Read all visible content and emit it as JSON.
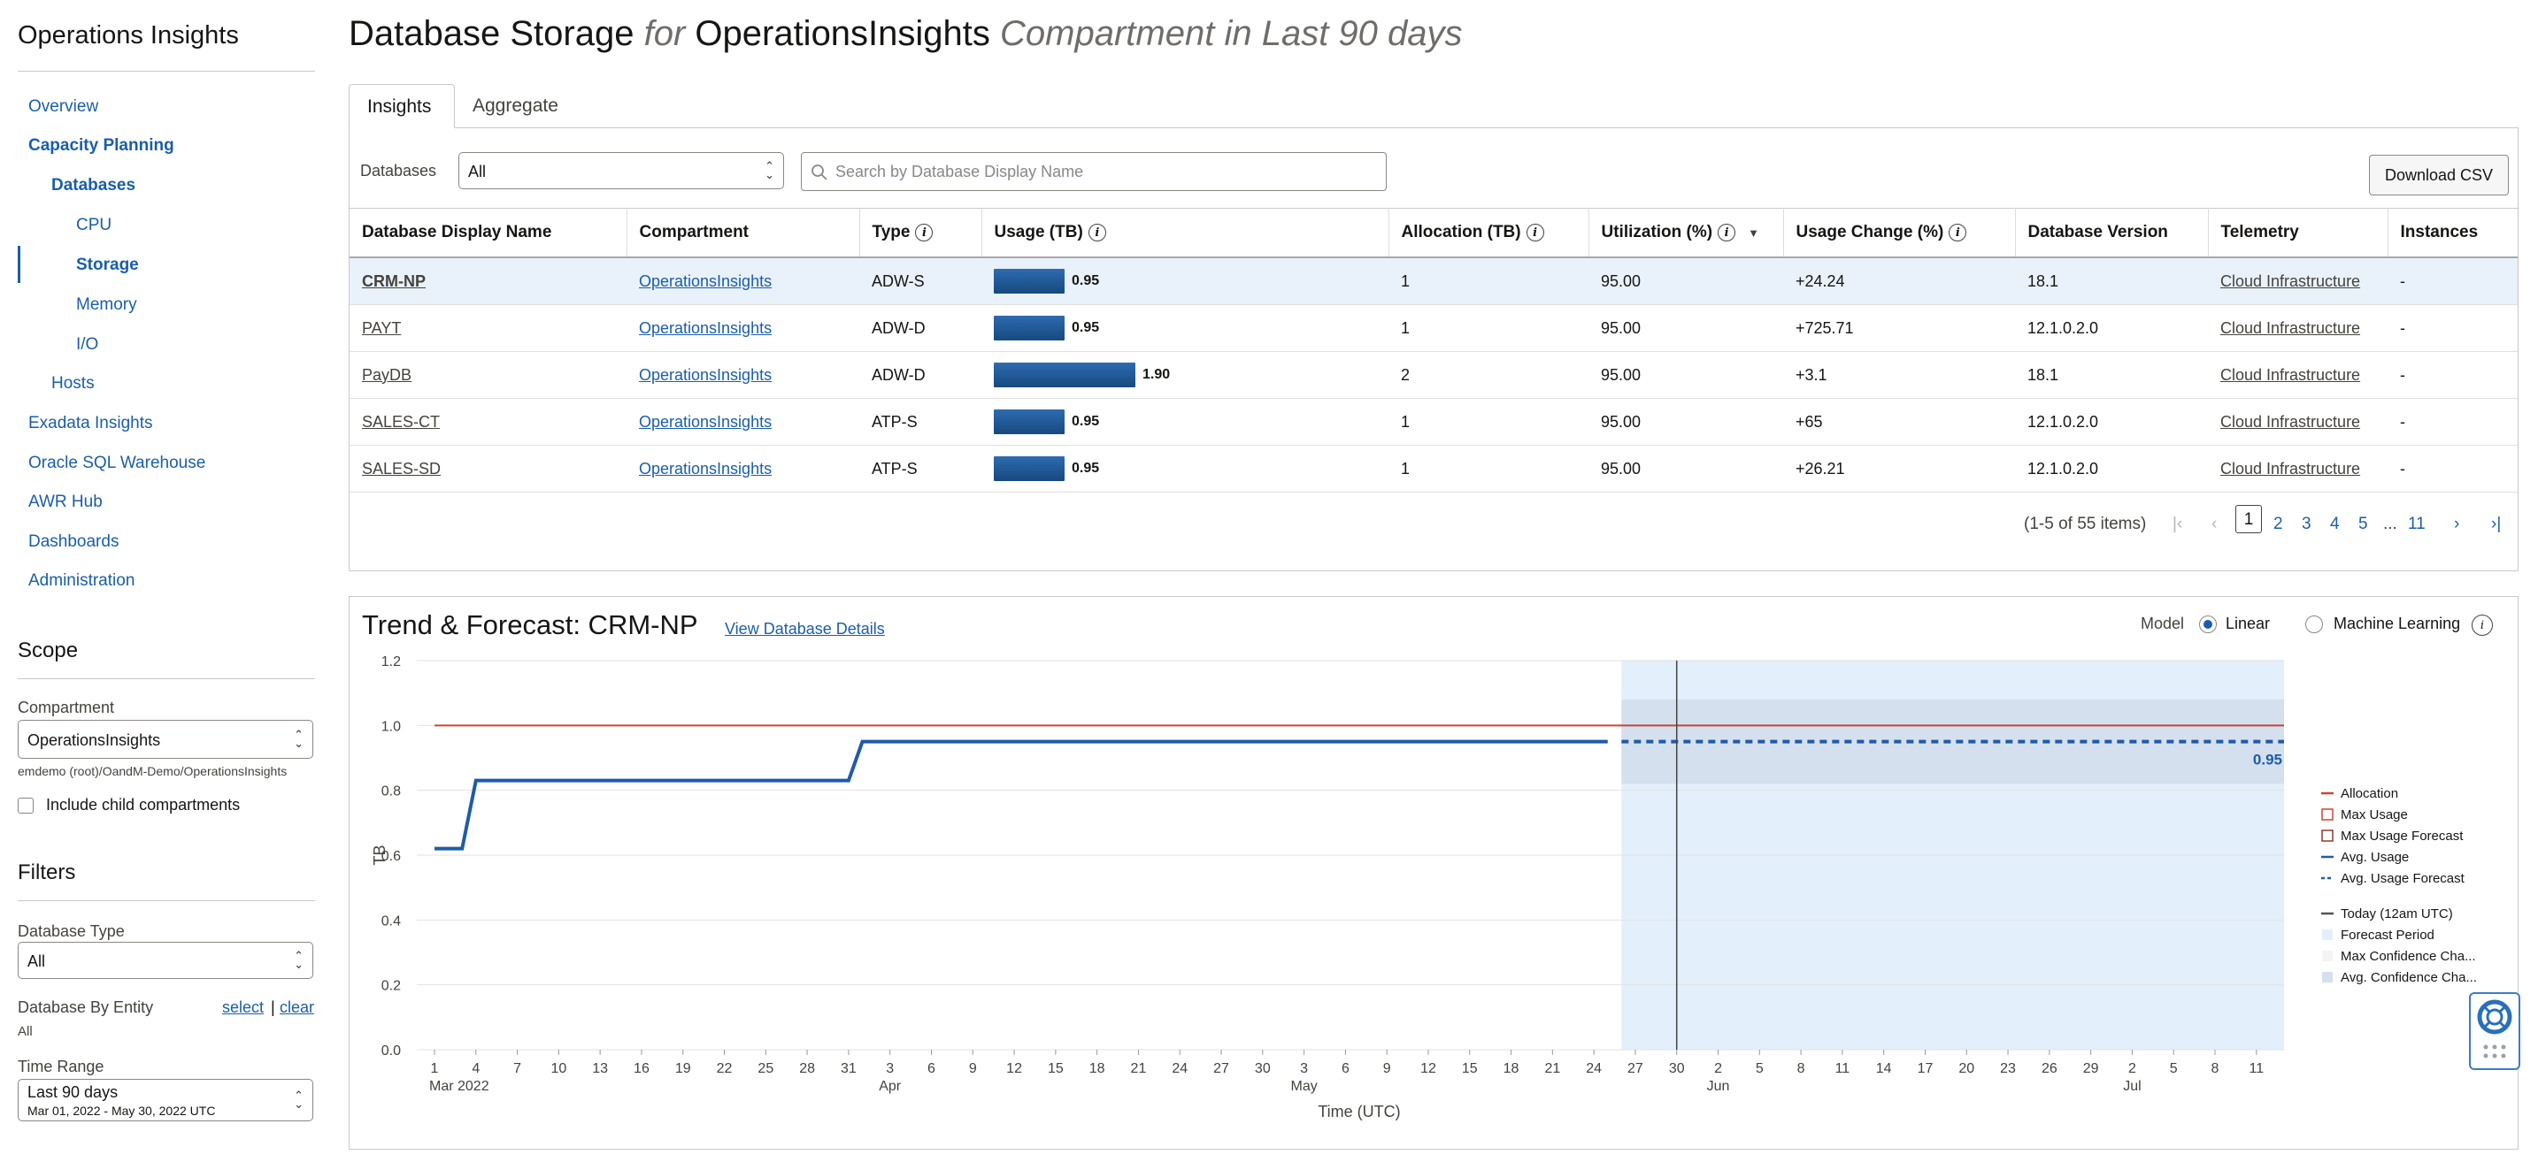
{
  "sidebar": {
    "app_title": "Operations Insights",
    "nav": [
      {
        "label": "Overview"
      },
      {
        "label": "Capacity Planning"
      },
      {
        "label": "Databases"
      },
      {
        "label": "CPU"
      },
      {
        "label": "Storage"
      },
      {
        "label": "Memory"
      },
      {
        "label": "I/O"
      },
      {
        "label": "Hosts"
      },
      {
        "label": "Exadata Insights"
      },
      {
        "label": "Oracle SQL Warehouse"
      },
      {
        "label": "AWR Hub"
      },
      {
        "label": "Dashboards"
      },
      {
        "label": "Administration"
      }
    ],
    "scope": {
      "title": "Scope",
      "compartment_label": "Compartment",
      "compartment_value": "OperationsInsights",
      "compartment_path": "emdemo (root)/OandM-Demo/OperationsInsights",
      "include_child_label": "Include child compartments"
    },
    "filters": {
      "title": "Filters",
      "db_type_label": "Database Type",
      "db_type_value": "All",
      "db_entity_label": "Database By Entity",
      "select_link": "select",
      "separator": "|",
      "clear_link": "clear",
      "db_entity_value": "All",
      "time_range_label": "Time Range",
      "time_range_value": "Last 90 days",
      "time_range_sub": "Mar 01, 2022 - May 30, 2022 UTC"
    }
  },
  "header": {
    "title_main": "Database Storage",
    "title_for": "for",
    "title_comp": "OperationsInsights",
    "title_suffix": "Compartment in Last 90 days"
  },
  "tabs": [
    {
      "label": "Insights"
    },
    {
      "label": "Aggregate"
    }
  ],
  "toolbar": {
    "databases_label": "Databases",
    "databases_value": "All",
    "search_placeholder": "Search by Database Display Name",
    "download_label": "Download CSV"
  },
  "table": {
    "columns": [
      "Database Display Name",
      "Compartment",
      "Type",
      "Usage (TB)",
      "Allocation (TB)",
      "Utilization (%)",
      "Usage Change (%)",
      "Database Version",
      "Telemetry",
      "Instances"
    ],
    "rows": [
      {
        "name": "CRM-NP",
        "compartment": "OperationsInsights",
        "type": "ADW-S",
        "usage": 0.95,
        "usage_label": "0.95",
        "allocation": "1",
        "utilization": "95.00",
        "change": "+24.24",
        "version": "18.1",
        "telemetry": "Cloud Infrastructure",
        "instances": "-"
      },
      {
        "name": "PAYT",
        "compartment": "OperationsInsights",
        "type": "ADW-D",
        "usage": 0.95,
        "usage_label": "0.95",
        "allocation": "1",
        "utilization": "95.00",
        "change": "+725.71",
        "version": "12.1.0.2.0",
        "telemetry": "Cloud Infrastructure",
        "instances": "-"
      },
      {
        "name": "PayDB",
        "compartment": "OperationsInsights",
        "type": "ADW-D",
        "usage": 1.9,
        "usage_label": "1.90",
        "allocation": "2",
        "utilization": "95.00",
        "change": "+3.1",
        "version": "18.1",
        "telemetry": "Cloud Infrastructure",
        "instances": "-"
      },
      {
        "name": "SALES-CT",
        "compartment": "OperationsInsights",
        "type": "ATP-S",
        "usage": 0.95,
        "usage_label": "0.95",
        "allocation": "1",
        "utilization": "95.00",
        "change": "+65",
        "version": "12.1.0.2.0",
        "telemetry": "Cloud Infrastructure",
        "instances": "-"
      },
      {
        "name": "SALES-SD",
        "compartment": "OperationsInsights",
        "type": "ATP-S",
        "usage": 0.95,
        "usage_label": "0.95",
        "allocation": "1",
        "utilization": "95.00",
        "change": "+26.21",
        "version": "12.1.0.2.0",
        "telemetry": "Cloud Infrastructure",
        "instances": "-"
      }
    ],
    "usage_max": 1.9
  },
  "pagination": {
    "summary": "(1-5 of 55 items)",
    "current": "1",
    "pages": [
      "2",
      "3",
      "4",
      "5"
    ],
    "ellipsis": "...",
    "last": "11"
  },
  "trend": {
    "title": "Trend & Forecast: CRM-NP",
    "link": "View Database Details",
    "model_label": "Model",
    "model_linear": "Linear",
    "model_ml": "Machine Learning"
  },
  "chart_data": {
    "type": "line",
    "ylabel": "TB",
    "xlabel": "Time (UTC)",
    "ylim": [
      0,
      1.2
    ],
    "yticks": [
      "0.0",
      "0.2",
      "0.4",
      "0.6",
      "0.8",
      "1.0",
      "1.2"
    ],
    "xticks": [
      "1",
      "4",
      "7",
      "10",
      "13",
      "16",
      "19",
      "22",
      "25",
      "28",
      "31",
      "3",
      "6",
      "9",
      "12",
      "15",
      "18",
      "21",
      "24",
      "27",
      "30",
      "3",
      "6",
      "9",
      "12",
      "15",
      "18",
      "21",
      "24",
      "27",
      "30",
      "2",
      "5",
      "8",
      "11",
      "14",
      "17",
      "20",
      "23",
      "26",
      "29",
      "2",
      "5",
      "8",
      "11"
    ],
    "month_labels": [
      {
        "at": 0,
        "label": "Mar 2022"
      },
      {
        "at": 11,
        "label": "Apr"
      },
      {
        "at": 21,
        "label": "May"
      },
      {
        "at": 31,
        "label": "Jun"
      },
      {
        "at": 41,
        "label": "Jul"
      }
    ],
    "x_start": "2022-03-01",
    "x_end": "2022-07-13",
    "grid": true,
    "series": [
      {
        "name": "Allocation",
        "color": "#c74634",
        "points": [
          [
            "2022-03-01",
            1.0
          ],
          [
            "2022-07-13",
            1.0
          ]
        ]
      },
      {
        "name": "Avg. Usage",
        "color": "#1f5ba8",
        "points": [
          [
            "2022-03-01",
            0.62
          ],
          [
            "2022-03-03",
            0.62
          ],
          [
            "2022-03-04",
            0.83
          ],
          [
            "2022-03-31",
            0.83
          ],
          [
            "2022-04-01",
            0.95
          ],
          [
            "2022-05-25",
            0.95
          ]
        ]
      },
      {
        "name": "Avg. Usage Forecast",
        "color": "#1f5ba8",
        "dashed": true,
        "points": [
          [
            "2022-05-26",
            0.95
          ],
          [
            "2022-07-13",
            0.95
          ]
        ]
      }
    ],
    "forecast_period": [
      "2022-05-26",
      "2022-07-13"
    ],
    "avg_confidence_band": [
      0.82,
      1.08
    ],
    "today": "2022-05-30",
    "end_label": "0.95",
    "legend": [
      {
        "name": "Allocation",
        "kind": "line",
        "color": "#c74634"
      },
      {
        "name": "Max Usage",
        "kind": "box",
        "color": "#c74634"
      },
      {
        "name": "Max Usage Forecast",
        "kind": "box",
        "color": "#8a3a2e"
      },
      {
        "name": "Avg. Usage",
        "kind": "line",
        "color": "#1f5ba8"
      },
      {
        "name": "Avg. Usage Forecast",
        "kind": "dash",
        "color": "#1f5ba8"
      },
      {
        "name": "Today (12am UTC)",
        "kind": "line",
        "color": "#555555"
      },
      {
        "name": "Forecast Period",
        "kind": "fill",
        "color": "#e3effb"
      },
      {
        "name": "Max Confidence Cha...",
        "kind": "fill",
        "color": "#f4f4f4"
      },
      {
        "name": "Avg. Confidence Cha...",
        "kind": "fill",
        "color": "#d5e0ef"
      }
    ],
    "legend_placement": "right"
  }
}
